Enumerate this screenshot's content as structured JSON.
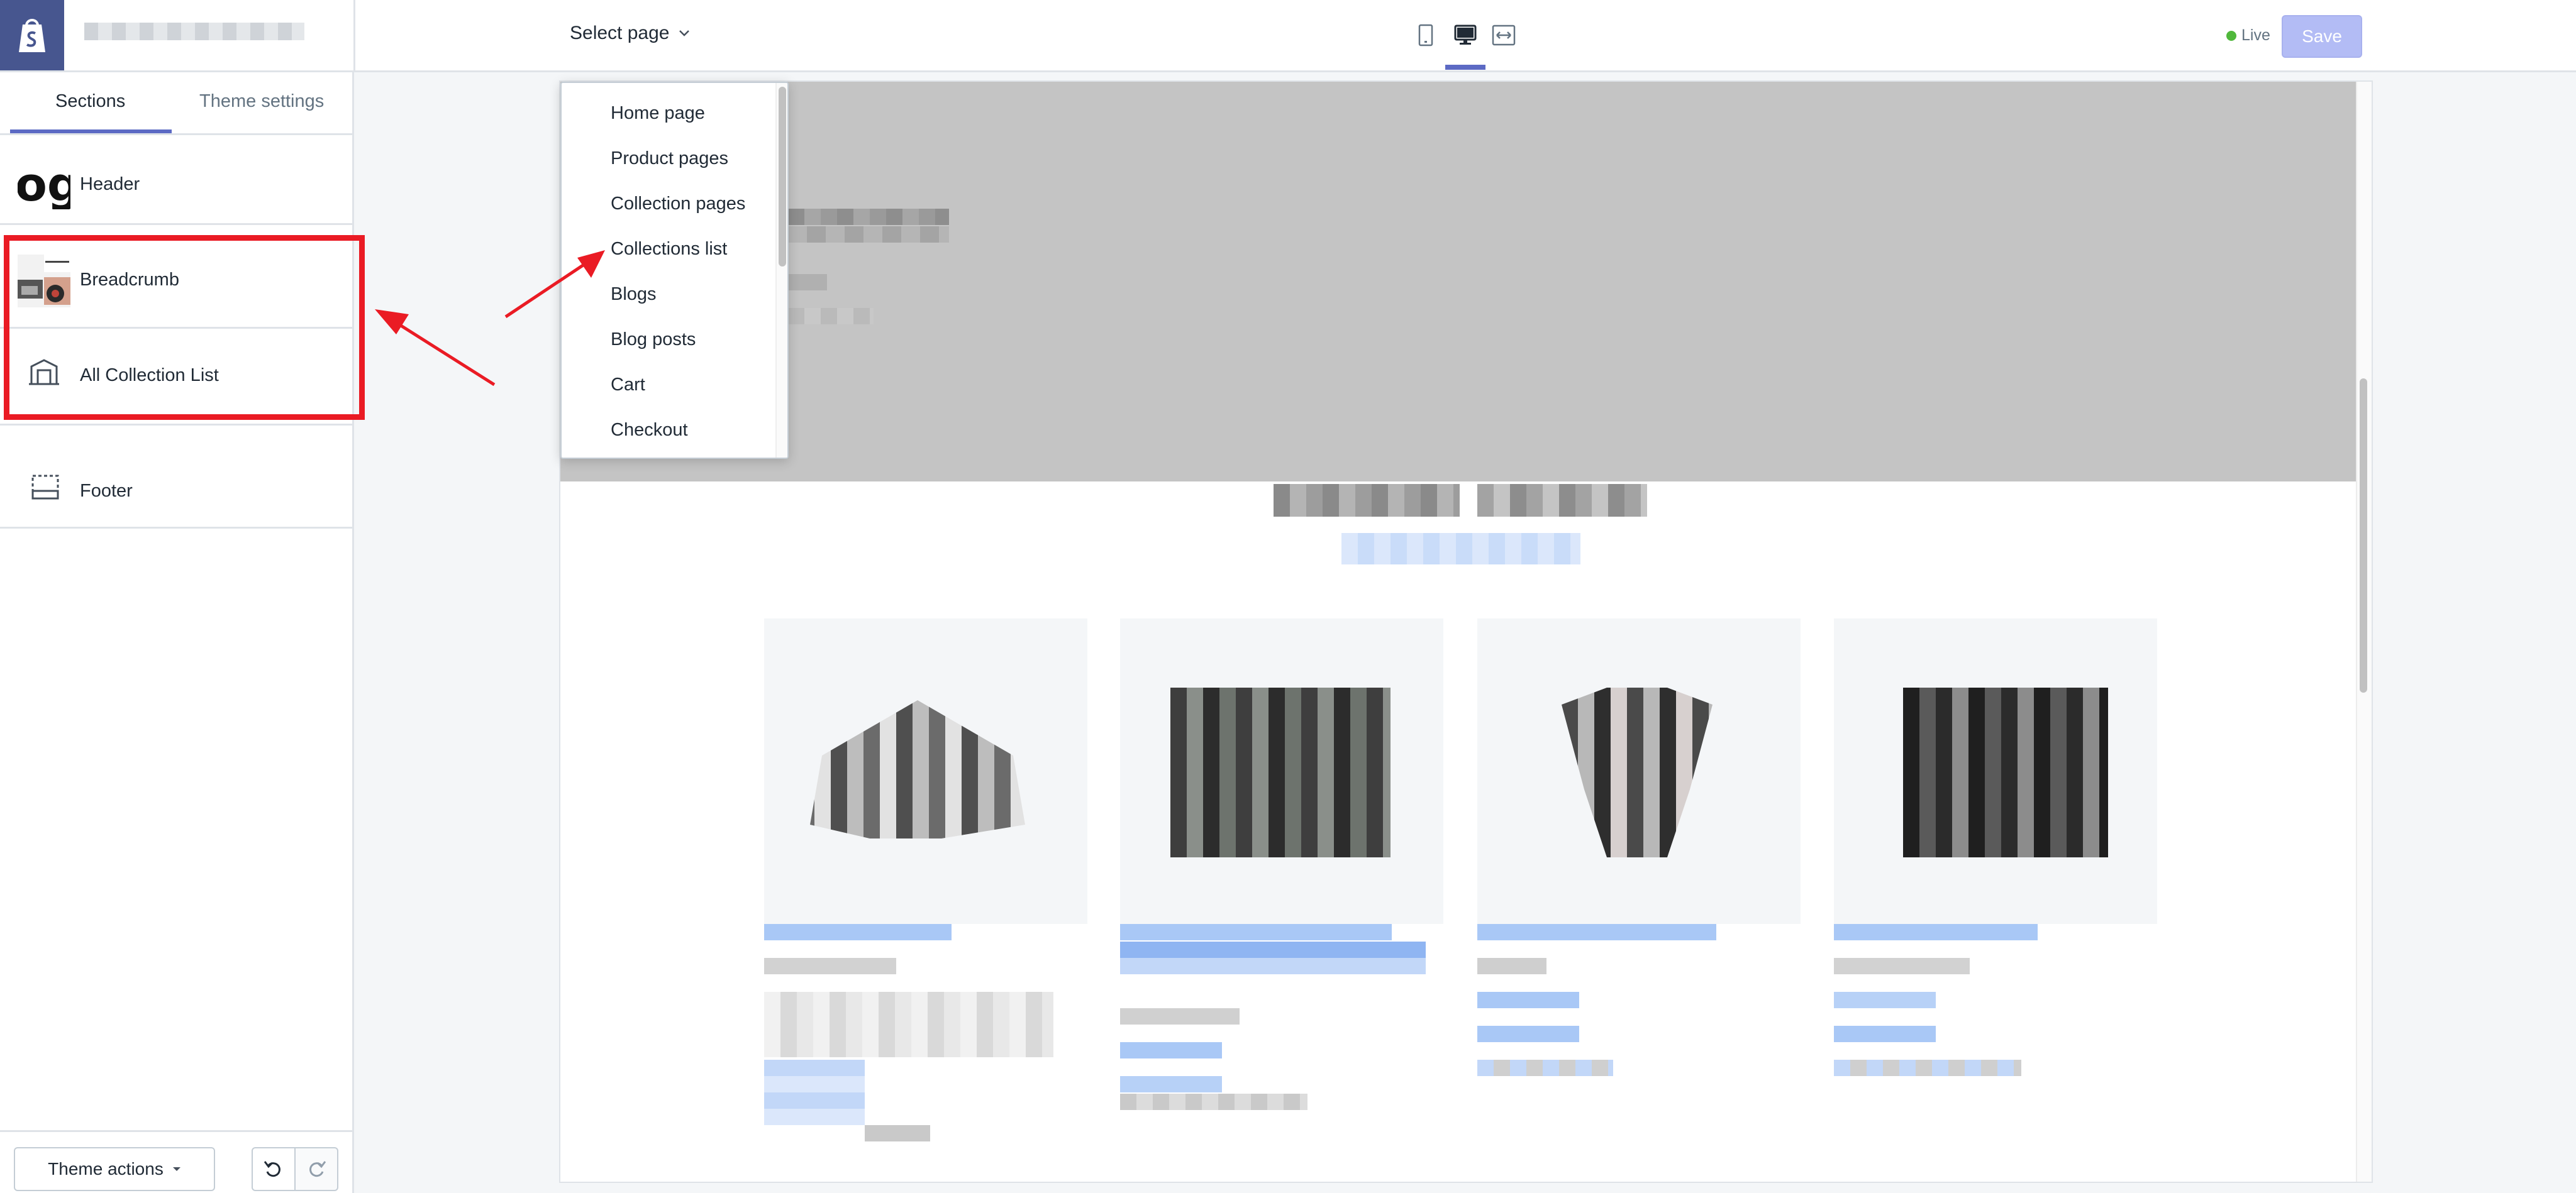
{
  "topbar": {
    "select_page_label": "Select page",
    "status": "Live",
    "save_label": "Save",
    "devices": [
      "mobile-icon",
      "desktop-icon",
      "fullscreen-icon"
    ],
    "active_device": "desktop"
  },
  "sidebar": {
    "tabs": [
      {
        "label": "Sections",
        "active": true
      },
      {
        "label": "Theme settings",
        "active": false
      }
    ],
    "sections": [
      {
        "label": "Header",
        "icon": "header-thumbnail"
      },
      {
        "label": "Breadcrumb",
        "icon": "breadcrumb-thumbnail"
      },
      {
        "label": "All Collection List",
        "icon": "collection-list-icon"
      },
      {
        "label": "Footer",
        "icon": "footer-icon"
      }
    ],
    "theme_actions_label": "Theme actions"
  },
  "dropdown": {
    "items": [
      "Home page",
      "Product pages",
      "Collection pages",
      "Collections list",
      "Blogs",
      "Blog posts",
      "Cart",
      "Checkout"
    ]
  },
  "colors": {
    "accent": "#5c6ac4",
    "shopify_logo_bg": "#47568f",
    "annotation_red": "#ea1b24",
    "live_green": "#50b83c",
    "save_disabled": "#b3bcf5"
  }
}
